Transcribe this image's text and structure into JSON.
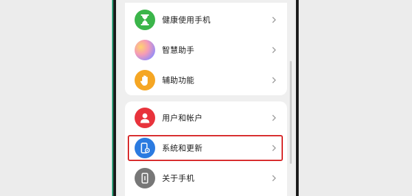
{
  "settings": {
    "items": [
      {
        "label": "健康使用手机",
        "icon": "hourglass-icon",
        "color": "#3bb54a"
      },
      {
        "label": "智慧助手",
        "icon": "smart-assistant-icon",
        "color": "#f0a8c6"
      },
      {
        "label": "辅助功能",
        "icon": "hand-icon",
        "color": "#f5a623"
      },
      {
        "label": "用户和帐户",
        "icon": "user-icon",
        "color": "#e8333c"
      },
      {
        "label": "系统和更新",
        "icon": "system-update-icon",
        "color": "#2b7be0"
      },
      {
        "label": "关于手机",
        "icon": "phone-info-icon",
        "color": "#777777"
      }
    ],
    "highlight_color": "#d7292a"
  }
}
